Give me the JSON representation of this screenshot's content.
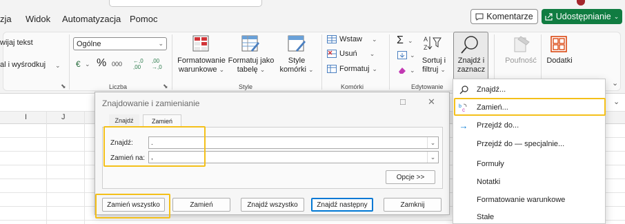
{
  "menubar": {
    "tabs": [
      "zja",
      "Widok",
      "Automatyzacja",
      "Pomoc"
    ],
    "comment_button": "Komentarze",
    "share_button": "Udostępnianie"
  },
  "ribbon": {
    "alignment": {
      "wrap_text": "wijaj tekst",
      "merge_center": "al i wyśrodkuj"
    },
    "number": {
      "format_value": "Ogólne",
      "currency_symbol": "€",
      "percent_symbol": "%",
      "thousands": "000",
      "increase_decimal": "←,0 ,00",
      "decrease_decimal": ",00 →,0",
      "group_label": "Liczba"
    },
    "styles": {
      "conditional_formatting": "Formatowanie warunkowe",
      "format_as_table": "Formatuj jako tabelę",
      "cell_styles": "Style komórki",
      "group_label": "Style"
    },
    "cells": {
      "insert": "Wstaw",
      "delete": "Usuń",
      "format": "Formatuj",
      "group_label": "Komórki"
    },
    "editing": {
      "sum_symbol": "Σ",
      "sort_filter": "Sortuj i filtruj",
      "find_select": "Znajdź i zaznacz",
      "group_label": "Edytowanie"
    },
    "sensitivity": "Poufność",
    "addins": "Dodatki"
  },
  "sheet": {
    "column_headers": [
      "I",
      "J"
    ]
  },
  "dialog": {
    "title": "Znajdowanie i zamienianie",
    "tabs": [
      "Znajdź",
      "Zamień"
    ],
    "find_label": "Znajdź:",
    "find_value": ".",
    "replace_label": "Zamień na:",
    "replace_value": ",",
    "options_button": "Opcje >>",
    "buttons": {
      "replace_all": "Zamień wszystko",
      "replace": "Zamień",
      "find_all": "Znajdź wszystko",
      "find_next": "Znajdź następny",
      "close": "Zamknij"
    },
    "controls": {
      "maximize": "□",
      "close": "✕"
    }
  },
  "find_menu": {
    "items": [
      {
        "label": "Znajdź...",
        "icon": "search-icon"
      },
      {
        "label": "Zamień...",
        "icon": "replace-icon"
      },
      {
        "label": "Przejdź do...",
        "icon": "arrow-right-icon"
      },
      {
        "label": "Przejdź do — specjalnie..."
      },
      {
        "label": "Formuły"
      },
      {
        "label": "Notatki"
      },
      {
        "label": "Formatowanie warunkowe"
      },
      {
        "label": "Stałe"
      }
    ]
  },
  "colors": {
    "accent_green": "#107c41",
    "highlight": "#f4c019",
    "blue": "#0078d4"
  }
}
